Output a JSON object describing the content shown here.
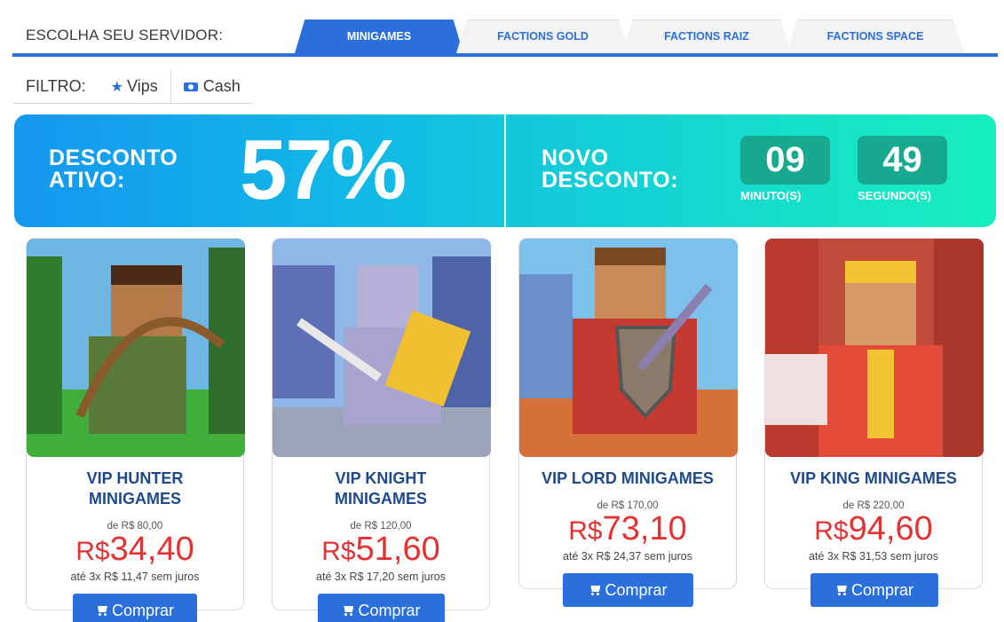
{
  "server": {
    "label": "ESCOLHA SEU SERVIDOR:",
    "tabs": [
      {
        "label": "MINIGAMES",
        "active": true
      },
      {
        "label": "FACTIONS GOLD",
        "active": false
      },
      {
        "label": "FACTIONS RAIZ",
        "active": false
      },
      {
        "label": "FACTIONS SPACE",
        "active": false
      }
    ]
  },
  "filter": {
    "label": "FILTRO:",
    "options": [
      {
        "label": "Vips",
        "icon": "star-icon"
      },
      {
        "label": "Cash",
        "icon": "cash-icon"
      }
    ]
  },
  "banner": {
    "active_line1": "DESCONTO",
    "active_line2": "ATIVO:",
    "percent": "57%",
    "next_line1": "NOVO",
    "next_line2": "DESCONTO:",
    "minutes": "09",
    "minutes_label": "MINUTO(S)",
    "seconds": "49",
    "seconds_label": "SEGUNDO(S)"
  },
  "products": [
    {
      "title_line1": "VIP HUNTER",
      "title_line2": "MINIGAMES",
      "old_price": "de R$ 80,00",
      "currency": "R$",
      "price": "34,40",
      "installments": "até 3x R$ 11,47 sem juros",
      "button": "Comprar"
    },
    {
      "title_line1": "VIP KNIGHT",
      "title_line2": "MINIGAMES",
      "old_price": "de R$ 120,00",
      "currency": "R$",
      "price": "51,60",
      "installments": "até 3x R$ 17,20 sem juros",
      "button": "Comprar"
    },
    {
      "title_line1": "VIP LORD MINIGAMES",
      "title_line2": "",
      "old_price": "de R$ 170,00",
      "currency": "R$",
      "price": "73,10",
      "installments": "até 3x R$ 24,37 sem juros",
      "button": "Comprar"
    },
    {
      "title_line1": "VIP KING MINIGAMES",
      "title_line2": "",
      "old_price": "de R$ 220,00",
      "currency": "R$",
      "price": "94,60",
      "installments": "até 3x R$ 31,53 sem juros",
      "button": "Comprar"
    }
  ],
  "colors": {
    "accent": "#2a6fdb",
    "price": "#e33232",
    "title": "#1e4a8c",
    "timer_box": "#17a98f"
  }
}
